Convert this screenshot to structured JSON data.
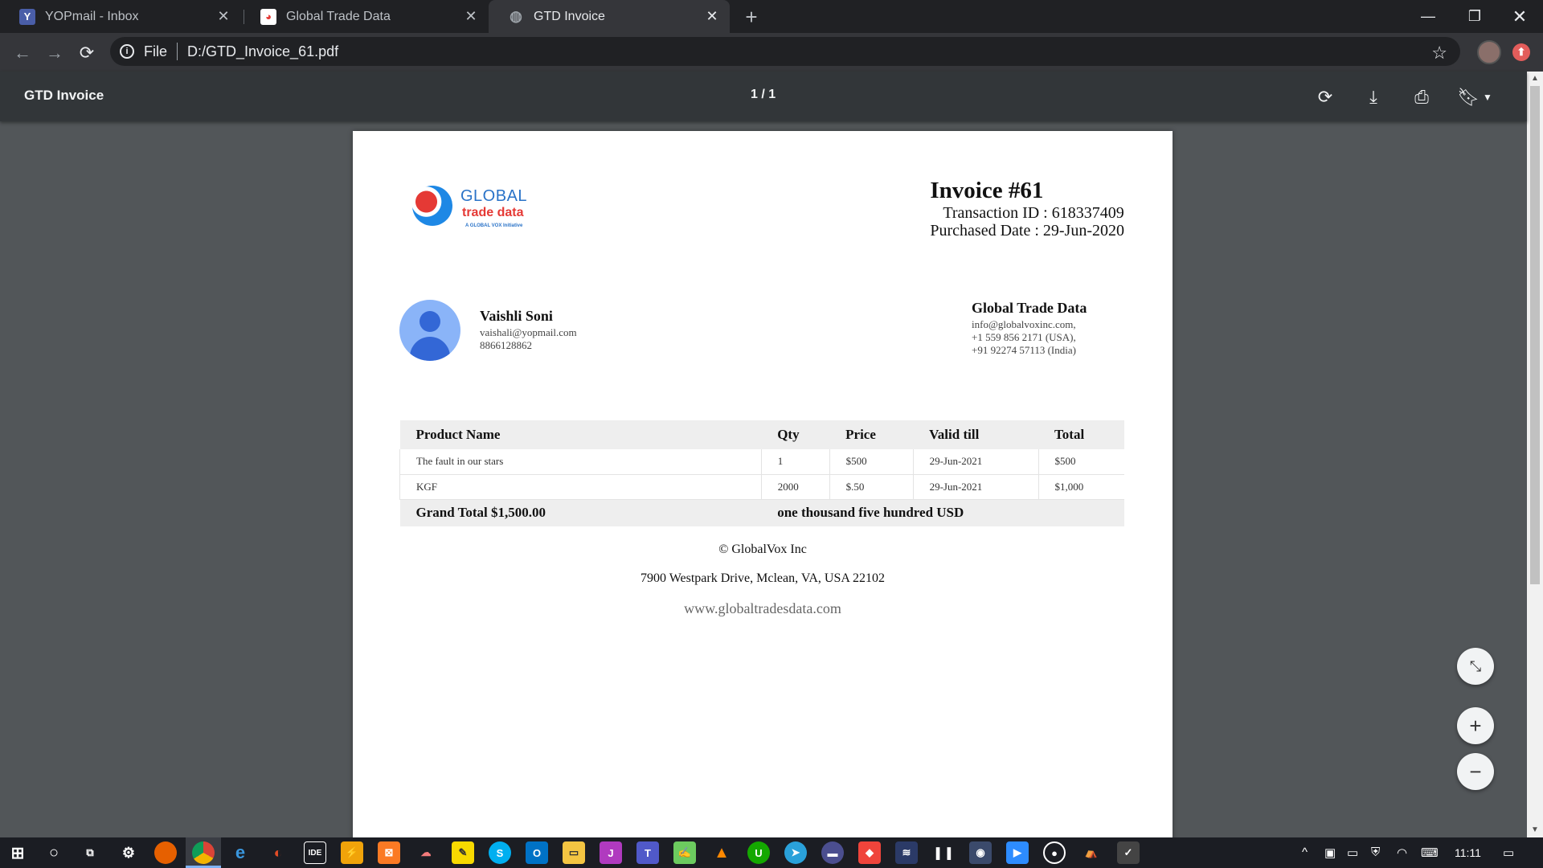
{
  "browser": {
    "tabs": [
      {
        "title": "YOPmail - Inbox",
        "favicon": "yopmail-icon",
        "active": false
      },
      {
        "title": "Global Trade Data",
        "favicon": "gtd-icon",
        "active": false
      },
      {
        "title": "GTD Invoice",
        "favicon": "globe-icon",
        "active": true
      }
    ],
    "new_tab_label": "+",
    "omnibox": {
      "scheme": "File",
      "url": "D:/GTD_Invoice_61.pdf"
    }
  },
  "pdf_viewer": {
    "title": "GTD Invoice",
    "page_indicator": "1 / 1"
  },
  "invoice": {
    "logo": {
      "line1": "GLOBAL",
      "line2": "trade data",
      "line3": "A GLOBAL VOX Initiative"
    },
    "title": "Invoice #61",
    "transaction_id": "Transaction ID : 618337409",
    "purchased_date": "Purchased Date : 29-Jun-2020",
    "customer": {
      "name": "Vaishli Soni",
      "email": "vaishali@yopmail.com",
      "phone": "8866128862"
    },
    "seller": {
      "name": "Global Trade Data",
      "email": "info@globalvoxinc.com,",
      "phone_usa": "+1 559 856 2171 (USA),",
      "phone_india": "+91 92274 57113 (India)"
    },
    "table": {
      "headers": [
        "Product Name",
        "Qty",
        "Price",
        "Valid till",
        "Total"
      ],
      "rows": [
        [
          "The fault in our stars",
          "1",
          "$500",
          "29-Jun-2021",
          "$500"
        ],
        [
          "KGF",
          "2000",
          "$.50",
          "29-Jun-2021",
          "$1,000"
        ]
      ],
      "grand_total": "Grand Total $1,500.00",
      "amount_words": "one thousand five hundred USD"
    },
    "footer": {
      "copyright": "© GlobalVox Inc",
      "address": "7900 Westpark Drive, Mclean, VA, USA 22102",
      "website": "www.globaltradesdata.com"
    }
  },
  "taskbar": {
    "time": "11:11"
  }
}
